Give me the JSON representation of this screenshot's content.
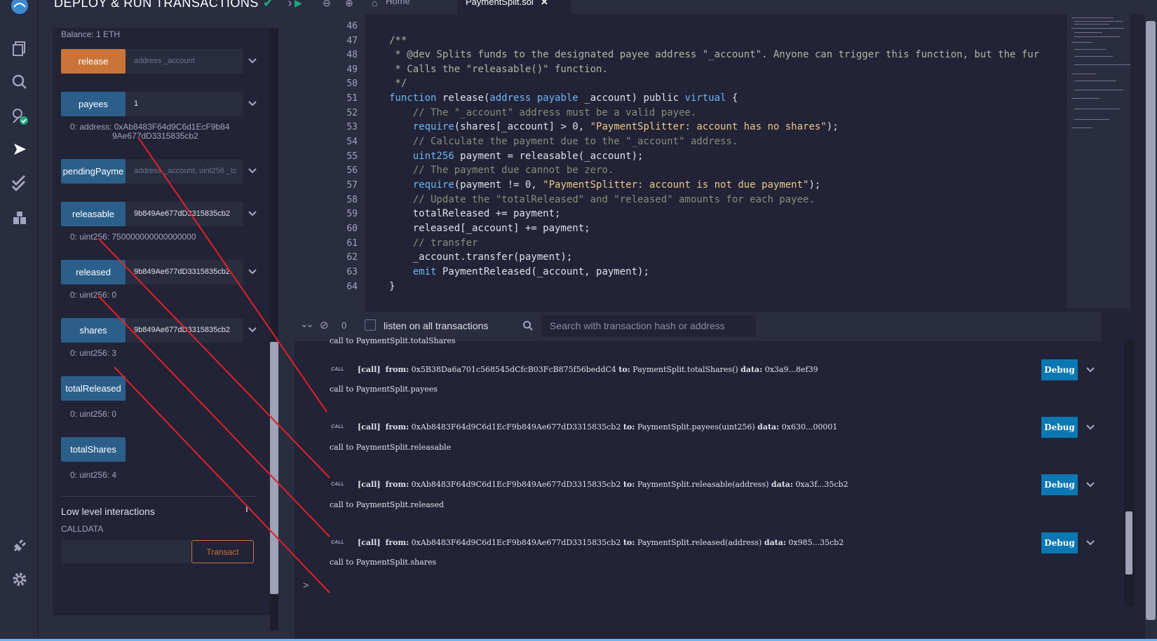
{
  "side_panel": {
    "title": "DEPLOY & RUN TRANSACTIONS",
    "balance": "Balance: 1 ETH",
    "functions": [
      {
        "label": "release",
        "input": "address _account",
        "input_is_placeholder": true,
        "output": "",
        "color": "#c97539"
      },
      {
        "label": "payees",
        "input": "1",
        "input_is_placeholder": false,
        "output": "0: address: 0xAb8483F64d9C6d1EcF9b849Ae677dD3315835cb2",
        "color": "#2b5f8a"
      },
      {
        "label": "pendingPayme",
        "input": "address _account, uint256 _tc",
        "input_is_placeholder": true,
        "output": "",
        "color": "#2b5f8a"
      },
      {
        "label": "releasable",
        "input": "9b849Ae677dD3315835cb2",
        "input_is_placeholder": false,
        "output": "0: uint256: 750000000000000000",
        "color": "#2b5f8a"
      },
      {
        "label": "released",
        "input": "9b849Ae677dD3315835cb2",
        "input_is_placeholder": false,
        "output": "0: uint256: 0",
        "color": "#2b5f8a"
      },
      {
        "label": "shares",
        "input": "9b849Ae677dD3315835cb2",
        "input_is_placeholder": false,
        "output": "0: uint256: 3",
        "color": "#2b5f8a"
      },
      {
        "label": "totalReleased",
        "input": "",
        "input_is_placeholder": false,
        "output": "0: uint256: 0",
        "color": "#2b5f8a"
      },
      {
        "label": "totalShares",
        "input": "",
        "input_is_placeholder": false,
        "output": "0: uint256: 4",
        "color": "#2b5f8a"
      }
    ],
    "payees_output_line1": "0: address: 0xAb8483F64d9C6d1EcF9b84",
    "payees_output_line2": "9Ae677dD3315835cb2",
    "low_level_label": "Low level interactions",
    "info_icon": "i",
    "calldata_label": "CALLDATA",
    "transact_label": "Transact"
  },
  "tabs": {
    "home": "Home",
    "file": "PaymentSplit.sol"
  },
  "editor": {
    "line_numbers": [
      "46",
      "47",
      "48",
      "49",
      "50",
      "51",
      "52",
      "53",
      "54",
      "55",
      "56",
      "57",
      "58",
      "59",
      "60",
      "61",
      "62",
      "63",
      "64"
    ]
  },
  "terminal": {
    "count": "0",
    "listen_label": "listen on all transactions",
    "search_placeholder": "Search with transaction hash or address",
    "entries": [
      {
        "header": "call to PaymentSplit.totalShares",
        "badge": "CALL",
        "tag": "[call]",
        "from_label": "from:",
        "from": "0x5B38Da6a701c568545dCfcB03FcB875f56beddC4",
        "to_label": "to:",
        "to": "PaymentSplit.totalShares()",
        "data_label": "data:",
        "data": "0x3a9...8ef39",
        "debug": "Debug"
      },
      {
        "header": "call to PaymentSplit.payees",
        "badge": "CALL",
        "tag": "[call]",
        "from_label": "from:",
        "from": "0xAb8483F64d9C6d1EcF9b849Ae677dD3315835cb2",
        "to_label": "to:",
        "to": "PaymentSplit.payees(uint256)",
        "data_label": "data:",
        "data": "0x630...00001",
        "debug": "Debug"
      },
      {
        "header": "call to PaymentSplit.releasable",
        "badge": "CALL",
        "tag": "[call]",
        "from_label": "from:",
        "from": "0xAb8483F64d9C6d1EcF9b849Ae677dD3315835cb2",
        "to_label": "to:",
        "to": "PaymentSplit.releasable(address)",
        "data_label": "data:",
        "data": "0xa3f...35cb2",
        "debug": "Debug"
      },
      {
        "header": "call to PaymentSplit.released",
        "badge": "CALL",
        "tag": "[call]",
        "from_label": "from:",
        "from": "0xAb8483F64d9C6d1EcF9b849Ae677dD3315835cb2",
        "to_label": "to:",
        "to": "PaymentSplit.released(address)",
        "data_label": "data:",
        "data": "0x985...35cb2",
        "debug": "Debug"
      }
    ],
    "last_header": "call to PaymentSplit.shares",
    "prompt": ">"
  },
  "colors": {
    "accent_orange": "#c97539",
    "function_blue": "#2b5f8a",
    "debug_blue": "#0b77b3",
    "annotation_red": "#e0202a",
    "success_green": "#1ea97c"
  }
}
